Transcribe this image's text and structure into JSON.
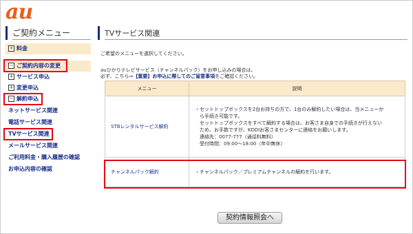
{
  "brand": {
    "logo": "au"
  },
  "sidebar": {
    "title": "ご契約メニュー",
    "items": [
      {
        "label": "料金",
        "expand": "+"
      },
      {
        "label": "ご契約内容の変更",
        "expand": "−"
      },
      {
        "label": "サービス申込",
        "expand": "+"
      },
      {
        "label": "変更申込",
        "expand": "+"
      },
      {
        "label": "解約申込",
        "expand": "−"
      },
      {
        "label": "ネットサービス関連"
      },
      {
        "label": "電話サービス関連"
      },
      {
        "label": "TVサービス関連"
      },
      {
        "label": "メールサービス関連"
      },
      {
        "label": "ご利用料金・購入履歴の確認"
      },
      {
        "label": "お申込内容の確認"
      }
    ]
  },
  "main": {
    "title": "TVサービス関連",
    "intro": {
      "line1": "ご希望のメニューを選択してください。",
      "line2": "auひかりテレビサービス（チャンネルパック）をお申し込みの場合は、",
      "line3_prefix": "必ず、こちら⇒",
      "line3_link": "【重要】お申込に際してのご留意事項",
      "line3_suffix": "をご確認ください。"
    },
    "table": {
      "headers": [
        "メニュー",
        "説明"
      ],
      "rows": [
        {
          "name": "STBレンタルサービス解約",
          "desc": [
            "・セットトップボックスを2台お持ちの方で、1台のみ解約したい場合は、当メニューか",
            "　ら手続き可能です。",
            "　セットトップボックスをすべて解約する場合は、お客さま自身での手続きが行えない",
            "　ため、お手数ですが、KDDIお客さまセンターに連絡をお願いします。",
            "　連絡先：0077-777（通話料無料）",
            "　受付時間：09:00～18:00（年中無休）"
          ]
        },
        {
          "name": "チャンネルパック解約",
          "desc": [
            "・チャンネルパック／プレミアムチャンネルの解約を行います。"
          ]
        }
      ]
    },
    "button_label": "契約情報照会へ"
  },
  "colors": {
    "brand": "#e8601c",
    "highlight": "#e60012",
    "header_band": "#fbe9cc",
    "link": "#1a2f8a"
  }
}
